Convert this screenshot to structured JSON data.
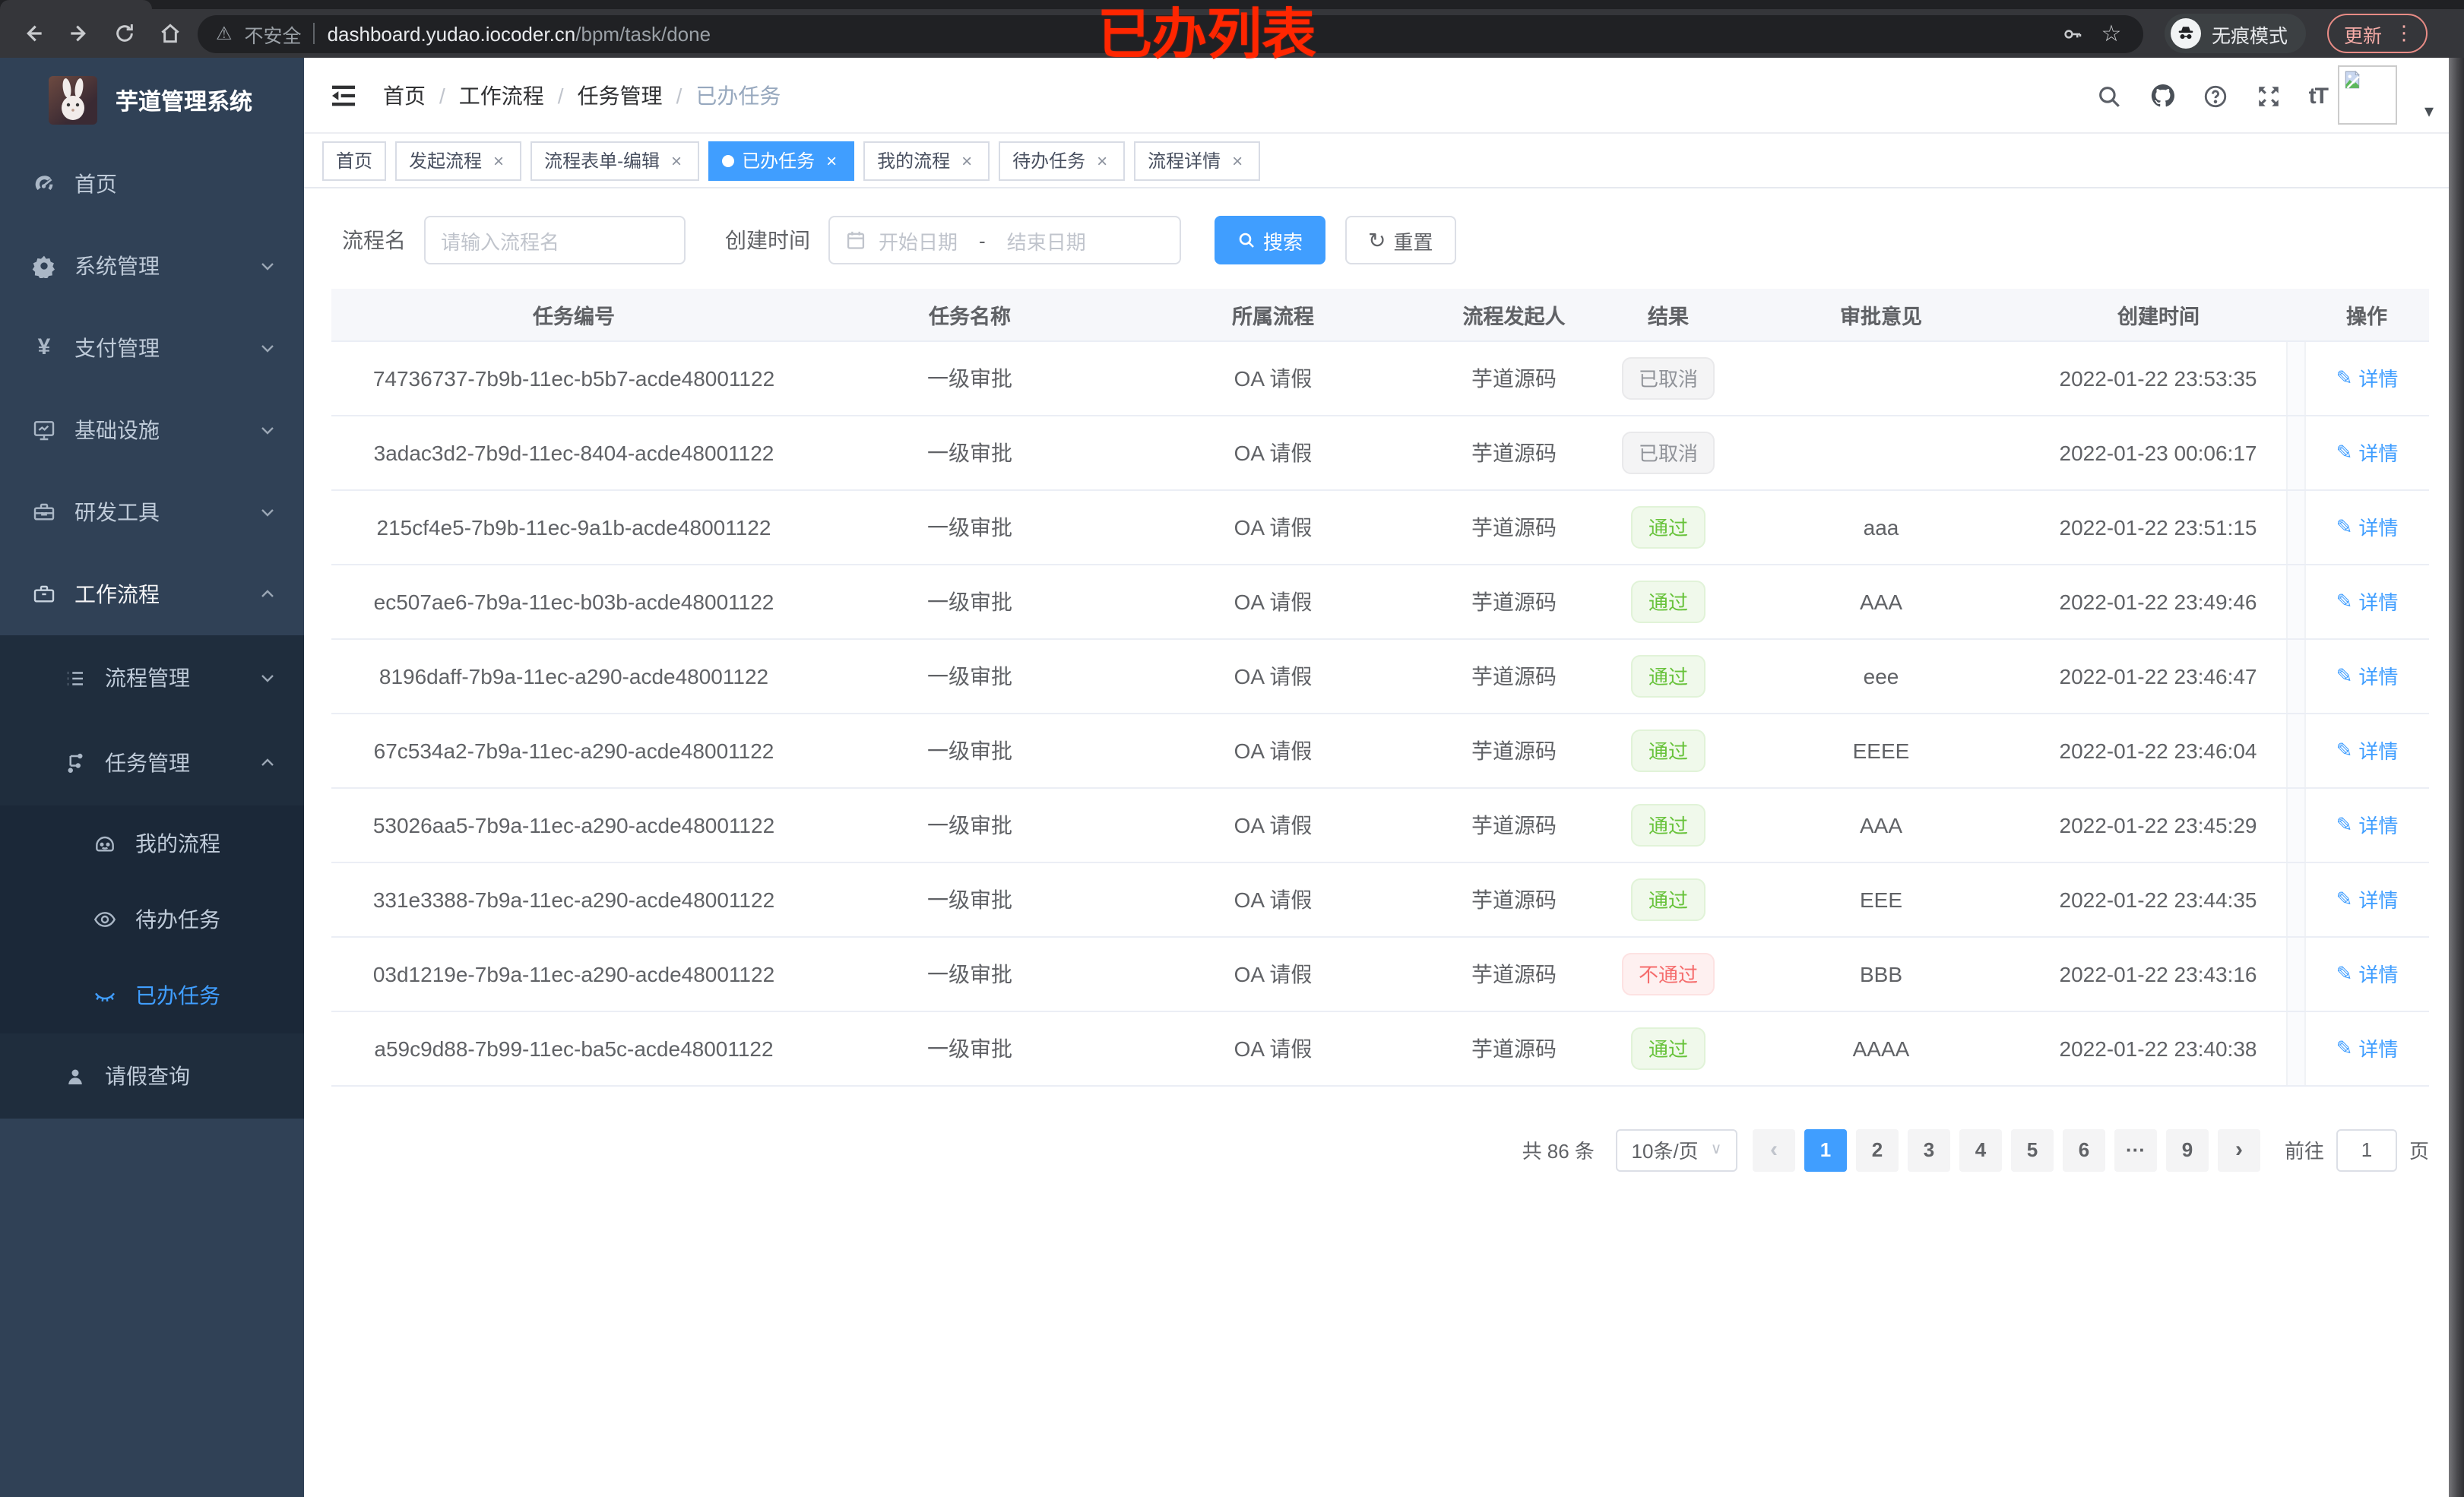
{
  "annotation": {
    "text": "已办列表"
  },
  "browser": {
    "security_label": "不安全",
    "url_host": "dashboard.yudao.iocoder.cn",
    "url_path": "/bpm/task/done",
    "incognito_label": "无痕模式",
    "update_label": "更新"
  },
  "icons": {
    "close_glyph": "×",
    "more_vertical": "⋮",
    "caret_down": "▾",
    "chevron_left": "‹",
    "chevron_right": "›",
    "edit_glyph": "✎",
    "refresh_glyph": "↻",
    "star_glyph": "☆",
    "warning_glyph": "⚠",
    "dot_glyph": "●",
    "ellipsis_glyph": "···",
    "font_size_glyph": "tT"
  },
  "app": {
    "title": "芋道管理系统"
  },
  "sidebar": {
    "items": [
      {
        "label": "首页"
      },
      {
        "label": "系统管理"
      },
      {
        "label": "支付管理"
      },
      {
        "label": "基础设施"
      },
      {
        "label": "研发工具"
      },
      {
        "label": "工作流程"
      },
      {
        "label": "流程管理"
      },
      {
        "label": "任务管理"
      },
      {
        "label": "我的流程"
      },
      {
        "label": "待办任务"
      },
      {
        "label": "已办任务"
      },
      {
        "label": "请假查询"
      }
    ]
  },
  "breadcrumb": {
    "items": [
      "首页",
      "工作流程",
      "任务管理",
      "已办任务"
    ],
    "separator": "/"
  },
  "tabs": [
    {
      "label": "首页"
    },
    {
      "label": "发起流程"
    },
    {
      "label": "流程表单-编辑"
    },
    {
      "label": "已办任务"
    },
    {
      "label": "我的流程"
    },
    {
      "label": "待办任务"
    },
    {
      "label": "流程详情"
    }
  ],
  "filters": {
    "name_label": "流程名",
    "name_placeholder": "请输入流程名",
    "time_label": "创建时间",
    "start_placeholder": "开始日期",
    "range_separator": "-",
    "end_placeholder": "结束日期",
    "search_label": "搜索",
    "reset_label": "重置"
  },
  "table": {
    "headers": [
      "任务编号",
      "任务名称",
      "所属流程",
      "流程发起人",
      "结果",
      "审批意见",
      "创建时间",
      "操作"
    ],
    "detail_label": "详情",
    "rows": [
      {
        "id": "74736737-7b9b-11ec-b5b7-acde48001122",
        "name": "一级审批",
        "process": "OA 请假",
        "starter": "芋道源码",
        "result": "已取消",
        "result_type": "info",
        "comment": "",
        "created": "2022-01-22 23:53:35"
      },
      {
        "id": "3adac3d2-7b9d-11ec-8404-acde48001122",
        "name": "一级审批",
        "process": "OA 请假",
        "starter": "芋道源码",
        "result": "已取消",
        "result_type": "info",
        "comment": "",
        "created": "2022-01-23 00:06:17"
      },
      {
        "id": "215cf4e5-7b9b-11ec-9a1b-acde48001122",
        "name": "一级审批",
        "process": "OA 请假",
        "starter": "芋道源码",
        "result": "通过",
        "result_type": "success",
        "comment": "aaa",
        "created": "2022-01-22 23:51:15"
      },
      {
        "id": "ec507ae6-7b9a-11ec-b03b-acde48001122",
        "name": "一级审批",
        "process": "OA 请假",
        "starter": "芋道源码",
        "result": "通过",
        "result_type": "success",
        "comment": "AAA",
        "created": "2022-01-22 23:49:46"
      },
      {
        "id": "8196daff-7b9a-11ec-a290-acde48001122",
        "name": "一级审批",
        "process": "OA 请假",
        "starter": "芋道源码",
        "result": "通过",
        "result_type": "success",
        "comment": "eee",
        "created": "2022-01-22 23:46:47"
      },
      {
        "id": "67c534a2-7b9a-11ec-a290-acde48001122",
        "name": "一级审批",
        "process": "OA 请假",
        "starter": "芋道源码",
        "result": "通过",
        "result_type": "success",
        "comment": "EEEE",
        "created": "2022-01-22 23:46:04"
      },
      {
        "id": "53026aa5-7b9a-11ec-a290-acde48001122",
        "name": "一级审批",
        "process": "OA 请假",
        "starter": "芋道源码",
        "result": "通过",
        "result_type": "success",
        "comment": "AAA",
        "created": "2022-01-22 23:45:29"
      },
      {
        "id": "331e3388-7b9a-11ec-a290-acde48001122",
        "name": "一级审批",
        "process": "OA 请假",
        "starter": "芋道源码",
        "result": "通过",
        "result_type": "success",
        "comment": "EEE",
        "created": "2022-01-22 23:44:35"
      },
      {
        "id": "03d1219e-7b9a-11ec-a290-acde48001122",
        "name": "一级审批",
        "process": "OA 请假",
        "starter": "芋道源码",
        "result": "不通过",
        "result_type": "danger",
        "comment": "BBB",
        "created": "2022-01-22 23:43:16"
      },
      {
        "id": "a59c9d88-7b99-11ec-ba5c-acde48001122",
        "name": "一级审批",
        "process": "OA 请假",
        "starter": "芋道源码",
        "result": "通过",
        "result_type": "success",
        "comment": "AAAA",
        "created": "2022-01-22 23:40:38"
      }
    ]
  },
  "pagination": {
    "total_label": "共 86 条",
    "page_size_label": "10条/页",
    "pages": [
      "1",
      "2",
      "3",
      "4",
      "5",
      "6"
    ],
    "last_page": "9",
    "active_page": "1",
    "goto_label": "前往",
    "goto_value": "1",
    "page_unit": "页"
  },
  "colors": {
    "accent": "#409eff",
    "success": "#67c23a",
    "danger": "#f56c6c",
    "info": "#909399",
    "sidebar_bg": "#304156",
    "submenu_bg": "#1f2d3d"
  }
}
